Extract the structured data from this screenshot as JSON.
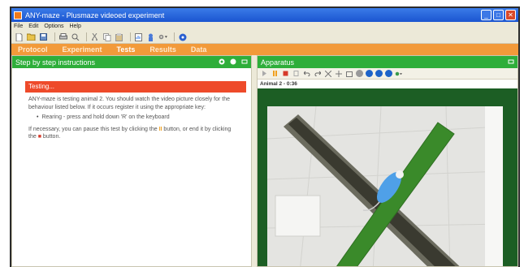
{
  "window": {
    "title": "ANY-maze - Plusmaze videoed experiment",
    "controls": {
      "minimize": "_",
      "maximize": "□",
      "close": "✕"
    }
  },
  "menu": [
    "File",
    "Edit",
    "Options",
    "Help"
  ],
  "tabs": [
    {
      "label": "Protocol",
      "active": false
    },
    {
      "label": "Experiment",
      "active": false
    },
    {
      "label": "Tests",
      "active": true
    },
    {
      "label": "Results",
      "active": false
    },
    {
      "label": "Data",
      "active": false
    }
  ],
  "instructions_pane": {
    "title": "Step by step instructions",
    "status": "Testing...",
    "text1": "ANY-maze is testing animal 2. You should watch the video picture closely for the behaviour listed below. If it occurs register it using the appropriate key:",
    "bullet": "Rearing - press and hold down 'R' on the keyboard",
    "text2_a": "If necessary, you can pause this test by clicking the",
    "text2_pause": "II",
    "text2_b": "button, or end it by clicking the",
    "text2_stop": "■",
    "text2_c": "button."
  },
  "apparatus_pane": {
    "title": "Apparatus",
    "animal_label": "Animal 2 - 0:36"
  },
  "colors": {
    "tab_bar": "#f29a3a",
    "pane_header": "#2eae3a",
    "status_bar": "#ee4a2a",
    "video_frame": "#1c5e24",
    "maze_arm": "#3a8a2a"
  }
}
